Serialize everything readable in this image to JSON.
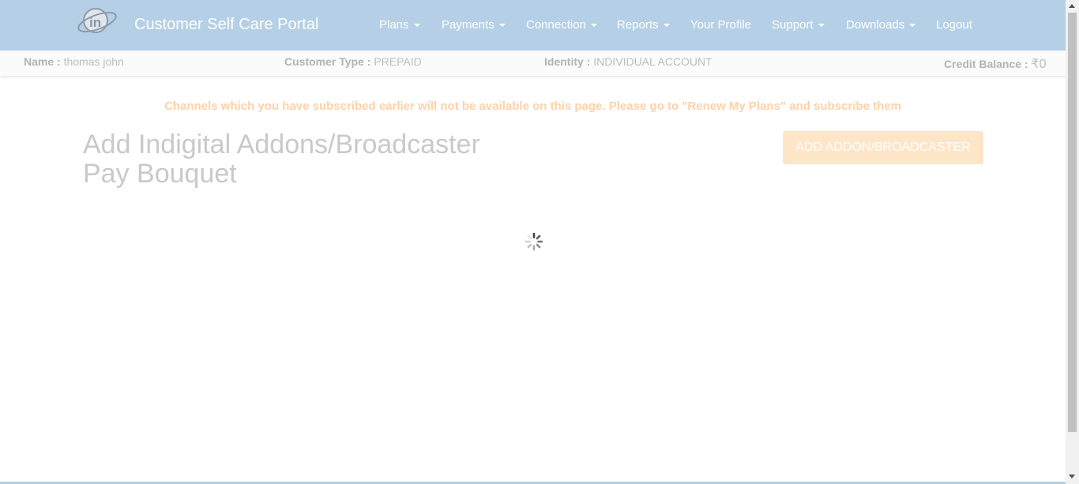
{
  "header": {
    "brand": "Customer Self Care Portal",
    "logo_icon": "in-globe-logo",
    "nav": [
      {
        "label": "Plans",
        "dropdown": true
      },
      {
        "label": "Payments",
        "dropdown": true
      },
      {
        "label": "Connection",
        "dropdown": true
      },
      {
        "label": "Reports",
        "dropdown": true
      },
      {
        "label": "Your Profile",
        "dropdown": false
      },
      {
        "label": "Support",
        "dropdown": true
      },
      {
        "label": "Downloads",
        "dropdown": true
      },
      {
        "label": "Logout",
        "dropdown": false
      }
    ]
  },
  "customer": {
    "name_label": "Name :",
    "name_value": "thomas john",
    "type_label": "Customer Type :",
    "type_value": "PREPAID",
    "identity_label": "Identity :",
    "identity_value": "INDIVIDUAL ACCOUNT",
    "balance_label": "Credit Balance :",
    "balance_value": "₹0"
  },
  "notice": "Channels which you have subscribed earlier will not be available on this page. Please go to \"Renew My Plans\" and subscribe them",
  "page": {
    "title": "Add Indigital Addons/Broadcaster Pay Bouquet",
    "add_button": "ADD ADDON/BROADCASTER"
  },
  "colors": {
    "navbar": "#b5d0e6",
    "notice": "#fcd2a8",
    "button": "#fde6c8"
  }
}
